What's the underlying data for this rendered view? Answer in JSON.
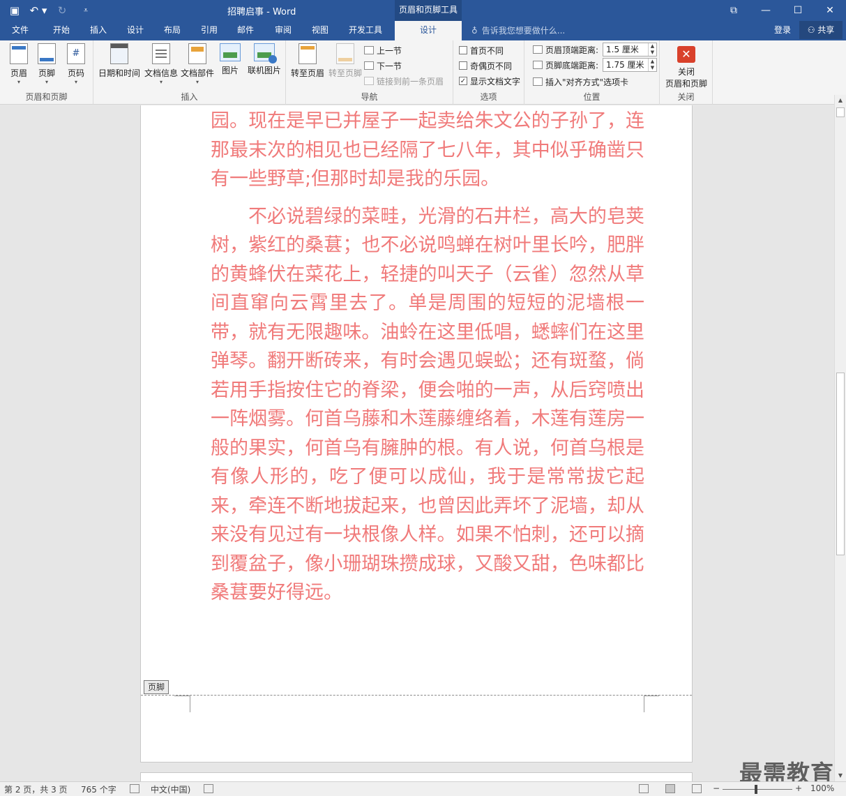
{
  "window": {
    "title": "招聘启事 - Word",
    "context_tab_header": "页眉和页脚工具"
  },
  "qat": {
    "save_icon": "save-icon",
    "undo_icon": "undo-icon",
    "redo_icon": "redo-icon",
    "customize_icon": "customize-qat-icon"
  },
  "tabs": [
    "文件",
    "开始",
    "插入",
    "设计",
    "布局",
    "引用",
    "邮件",
    "审阅",
    "视图",
    "开发工具",
    "设计"
  ],
  "tell_me": "告诉我您想要做什么...",
  "signin": "登录",
  "share": "共享",
  "ribbon": {
    "groups": {
      "header_footer": {
        "label": "页眉和页脚",
        "header": "页眉",
        "footer": "页脚",
        "page_number": "页码"
      },
      "insert": {
        "label": "插入",
        "date_time": "日期和时间",
        "doc_info": "文档信息",
        "doc_parts": "文档部件",
        "picture": "图片",
        "online_picture": "联机图片"
      },
      "navigation": {
        "label": "导航",
        "goto_header": "转至页眉",
        "goto_footer": "转至页脚",
        "prev_section": "上一节",
        "next_section": "下一节",
        "link_previous": "链接到前一条页眉"
      },
      "options": {
        "label": "选项",
        "diff_first": "首页不同",
        "diff_odd_even": "奇偶页不同",
        "show_doc_text": "显示文档文字",
        "show_doc_text_checked": true
      },
      "position": {
        "label": "位置",
        "header_top_label": "页眉顶端距离:",
        "header_top_value": "1.5 厘米",
        "footer_bottom_label": "页脚底端距离:",
        "footer_bottom_value": "1.75 厘米",
        "insert_align_tab": "插入\"对齐方式\"选项卡"
      },
      "close": {
        "label": "关闭",
        "close_line1": "关闭",
        "close_line2": "页眉和页脚"
      }
    }
  },
  "document": {
    "paragraphs": [
      "园。现在是早已并屋子一起卖给朱文公的子孙了，连那最末次的相见也已经隔了七八年，其中似乎确凿只有一些野草;但那时却是我的乐园。",
      "不必说碧绿的菜畦，光滑的石井栏，高大的皂荚树，紫红的桑葚；也不必说鸣蝉在树叶里长吟，肥胖的黄蜂伏在菜花上，轻捷的叫天子（云雀）忽然从草间直窜向云霄里去了。单是周围的短短的泥墙根一带，就有无限趣味。油蛉在这里低唱，蟋蟀们在这里弹琴。翻开断砖来，有时会遇见蜈蚣；还有斑蝥，倘若用手指按住它的脊梁，便会啪的一声，从后窍喷出一阵烟雾。何首乌藤和木莲藤缠络着，木莲有莲房一般的果实，何首乌有臃肿的根。有人说，何首乌根是有像人形的，吃了便可以成仙，我于是常常拔它起来，牵连不断地拔起来，也曾因此弄坏了泥墙，却从来没有见过有一块根像人样。如果不怕刺，还可以摘到覆盆子，像小珊瑚珠攒成球，又酸又甜，色味都比桑葚要好得远。"
    ],
    "text_color": "#f07a7a",
    "footer_tag": "页脚"
  },
  "status": {
    "page": "第 2 页，共 3 页",
    "words": "765 个字",
    "language": "中文(中国)",
    "zoom": "100%"
  },
  "watermark": "最需教育",
  "colors": {
    "accent": "#2b579a",
    "ribbon_bg": "#f4f4f4"
  }
}
